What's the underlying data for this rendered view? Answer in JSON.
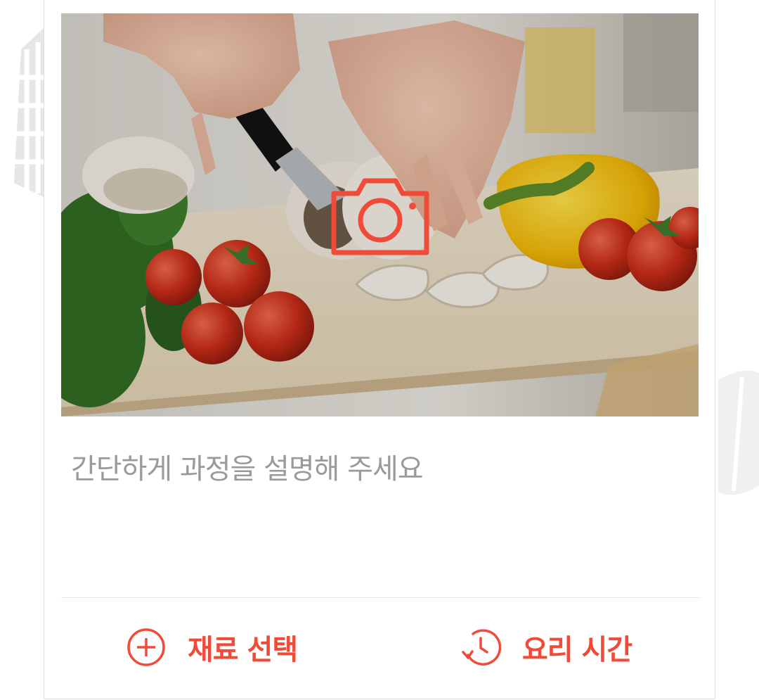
{
  "step_card": {
    "photo": {
      "description": "Hands slicing mushrooms on a wooden cutting board with cherry tomatoes, parsley and yellow bell pepper",
      "upload_icon": "camera-icon"
    },
    "description_placeholder": "간단하게 과정을 설명해 주세요",
    "actions": [
      {
        "label": "재료 선택",
        "icon": "plus-circle-icon"
      },
      {
        "label": "요리 시간",
        "icon": "clock-history-icon"
      }
    ]
  },
  "colors": {
    "accent": "#f04b38",
    "placeholder_text": "#9a9a9a",
    "divider": "#e3e3e3",
    "card_border": "#dcdcdc"
  }
}
